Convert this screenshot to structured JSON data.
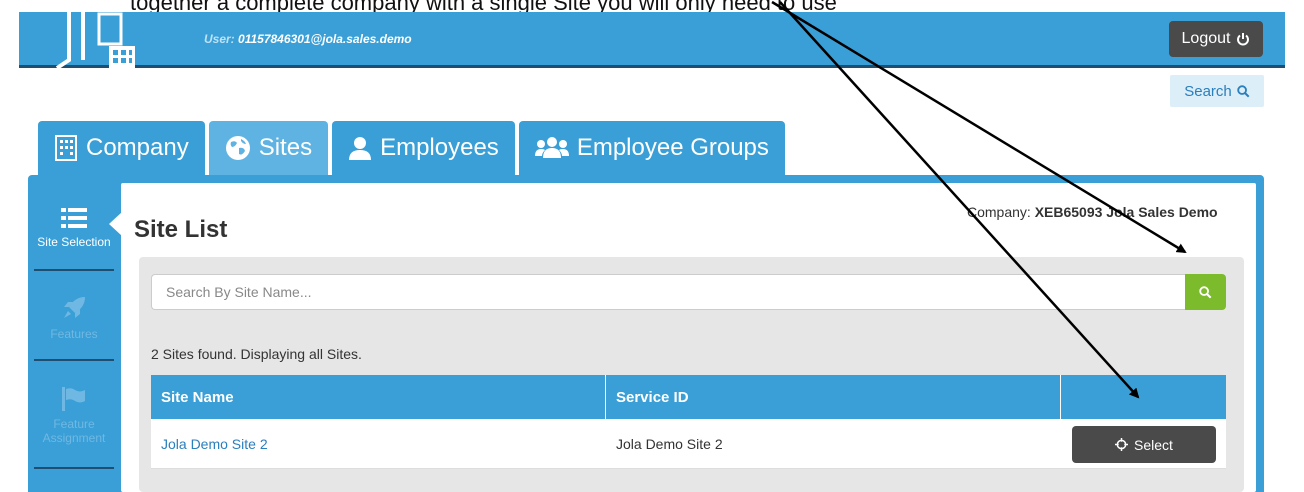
{
  "instruction_text": "together a complete company with a single Site you will only need to use",
  "header": {
    "user_label": "User:",
    "user_value": "01157846301@jola.sales.demo",
    "logout_label": "Logout"
  },
  "search_link_label": "Search",
  "tabs": [
    {
      "label": "Company",
      "icon": "building-icon"
    },
    {
      "label": "Sites",
      "icon": "globe-icon"
    },
    {
      "label": "Employees",
      "icon": "user-icon"
    },
    {
      "label": "Employee Groups",
      "icon": "users-icon"
    }
  ],
  "side_nav": [
    {
      "label": "Site Selection",
      "icon": "list-icon"
    },
    {
      "label": "Features",
      "icon": "rocket-icon"
    },
    {
      "label": "Feature Assignment",
      "icon": "flag-icon"
    }
  ],
  "main": {
    "title": "Site List",
    "company_label": "Company:",
    "company_value": "XEB65093 Jola Sales Demo",
    "search_placeholder": "Search By Site Name...",
    "found_text": "2 Sites found. Displaying all Sites.",
    "columns": [
      "Site Name",
      "Service ID",
      ""
    ],
    "rows": [
      {
        "site_name": "Jola Demo Site 2",
        "service_id": "Jola Demo Site 2",
        "action": "Select"
      }
    ]
  },
  "colors": {
    "primary": "#3a9fd6",
    "dark_button": "#4a4a4a",
    "success": "#7cbb2b",
    "link": "#2a7fbd"
  }
}
